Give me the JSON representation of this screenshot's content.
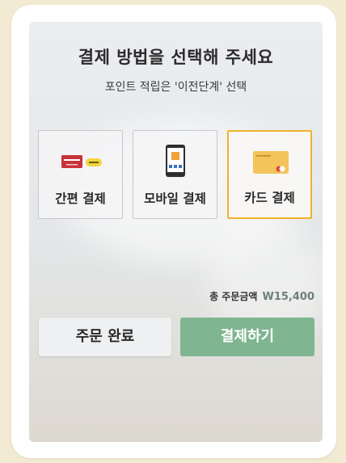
{
  "screen": {
    "title": "결제 방법을 선택해 주세요",
    "subtitle": "포인트 적립은 '이전단계' 선택"
  },
  "payment_options": [
    {
      "label": "간편 결제",
      "icon": "easy-pay-cards-icon",
      "selected": false
    },
    {
      "label": "모바일 결제",
      "icon": "mobile-phone-icon",
      "selected": false
    },
    {
      "label": "카드 결제",
      "icon": "credit-card-icon",
      "selected": true
    }
  ],
  "order": {
    "total_label": "총 주문금액",
    "total_amount": "W15,400"
  },
  "buttons": {
    "complete_label": "주문 완료",
    "pay_label": "결제하기"
  },
  "colors": {
    "page_background": "#f3ead3",
    "selected_border": "#f0b22a",
    "pay_button": "#7fb591",
    "total_amount": "#6f7f78"
  }
}
